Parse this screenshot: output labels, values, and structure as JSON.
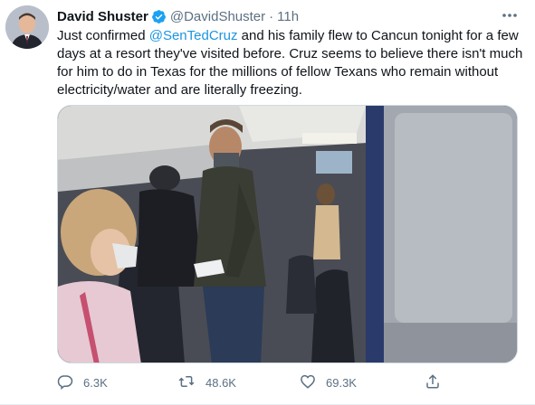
{
  "author": {
    "name": "David Shuster",
    "handle": "@DavidShuster",
    "separator": "·",
    "time": "11h",
    "verified": true
  },
  "tweet": {
    "text_before": "Just confirmed ",
    "mention": "@SenTedCruz",
    "text_after": " and his family flew to Cancun tonight for a few days at a resort they've visited before. Cruz seems to believe there isn't much for him to do in Texas for the millions of fellow Texans who remain without electricity/water and are literally freezing."
  },
  "actions": {
    "replies": "6.3K",
    "retweets": "48.6K",
    "likes": "69.3K"
  },
  "icons": {
    "verified": "verified-badge-icon",
    "more": "more-options-icon",
    "reply": "reply-icon",
    "retweet": "retweet-icon",
    "like": "heart-icon",
    "share": "share-icon"
  },
  "colors": {
    "accent": "#1b95e0",
    "secondary_text": "#5b7083",
    "primary_text": "#0f1419"
  }
}
